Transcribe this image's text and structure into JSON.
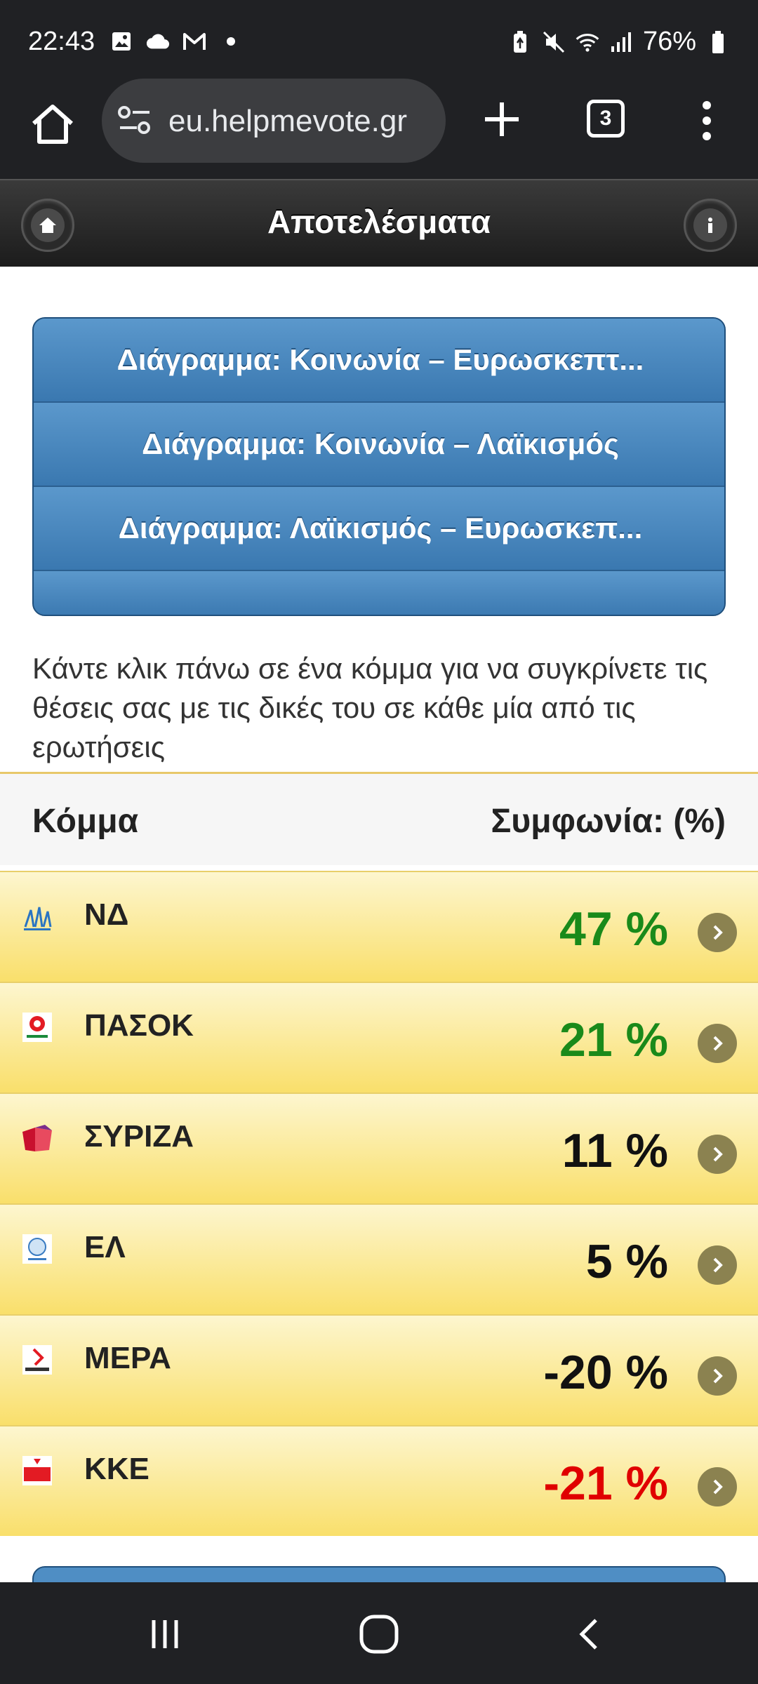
{
  "status": {
    "time": "22:43",
    "battery": "76%",
    "icons_left": [
      "image-icon",
      "cloud-icon",
      "gmail-icon",
      "dot-icon"
    ],
    "icons_right": [
      "battery-saver-icon",
      "mute-icon",
      "wifi-icon",
      "signal-icon",
      "battery-icon"
    ]
  },
  "browser": {
    "url": "eu.helpmevote.gr",
    "tab_count": "3"
  },
  "header": {
    "title": "Αποτελέσματα"
  },
  "chart_buttons": [
    {
      "label": "Διάγραμμα: Κοινωνία – Ευρωσκεπτ..."
    },
    {
      "label": "Διάγραμμα: Κοινωνία – Λαϊκισμός"
    },
    {
      "label": "Διάγραμμα: Λαϊκισμός – Ευρωσκεπ..."
    },
    {
      "label": ""
    }
  ],
  "instructions": "Κάντε κλικ πάνω σε ένα κόμμα για να συγκρίνετε τις θέσεις σας με τις δικές του σε κάθε μία από τις ερωτήσεις",
  "table": {
    "col_party": "Κόμμα",
    "col_agreement": "Συμφωνία: (%)",
    "rows": [
      {
        "name": "ΝΔ",
        "pct": "47 %",
        "color": "#1a8a1a",
        "logo": "nd-logo-icon"
      },
      {
        "name": "ΠΑΣΟΚ",
        "pct": "21 %",
        "color": "#1a8a1a",
        "logo": "pasok-logo-icon"
      },
      {
        "name": "ΣΥΡΙΖΑ",
        "pct": "11 %",
        "color": "#111111",
        "logo": "syriza-logo-icon"
      },
      {
        "name": "ΕΛ",
        "pct": "5 %",
        "color": "#111111",
        "logo": "el-logo-icon"
      },
      {
        "name": "ΜΕΡΑ",
        "pct": "-20 %",
        "color": "#111111",
        "logo": "mera-logo-icon"
      },
      {
        "name": "ΚΚΕ",
        "pct": "-21 %",
        "color": "#e00000",
        "logo": "kke-logo-icon"
      }
    ]
  },
  "nav": [
    "recents-icon",
    "home-icon",
    "back-icon"
  ]
}
